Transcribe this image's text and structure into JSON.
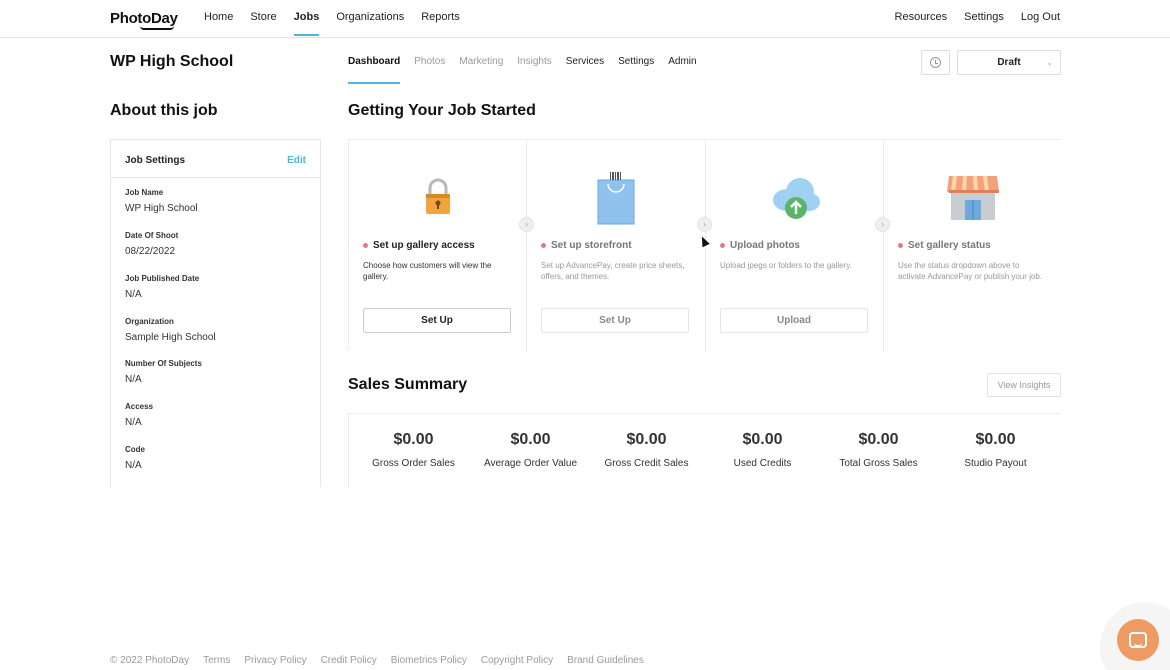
{
  "brand": {
    "logo": "PhotoDay"
  },
  "topnav": {
    "left": [
      {
        "label": "Home",
        "active": false
      },
      {
        "label": "Store",
        "active": false
      },
      {
        "label": "Jobs",
        "active": true
      },
      {
        "label": "Organizations",
        "active": false
      },
      {
        "label": "Reports",
        "active": false
      }
    ],
    "right": [
      {
        "label": "Resources"
      },
      {
        "label": "Settings"
      },
      {
        "label": "Log Out"
      }
    ]
  },
  "job": {
    "title": "WP High School",
    "tabs": [
      {
        "label": "Dashboard",
        "state": "active"
      },
      {
        "label": "Photos",
        "state": "dim"
      },
      {
        "label": "Marketing",
        "state": "dim"
      },
      {
        "label": "Insights",
        "state": "dim"
      },
      {
        "label": "Services",
        "state": "normal"
      },
      {
        "label": "Settings",
        "state": "normal"
      },
      {
        "label": "Admin",
        "state": "normal"
      }
    ],
    "status": "Draft"
  },
  "about": {
    "title": "About this job",
    "card_title": "Job Settings",
    "edit_label": "Edit",
    "fields": [
      {
        "label": "Job Name",
        "value": "WP High School"
      },
      {
        "label": "Date Of Shoot",
        "value": "08/22/2022"
      },
      {
        "label": "Job Published Date",
        "value": "N/A"
      },
      {
        "label": "Organization",
        "value": "Sample High School"
      },
      {
        "label": "Number Of Subjects",
        "value": "N/A"
      },
      {
        "label": "Access",
        "value": "N/A"
      },
      {
        "label": "Code",
        "value": "N/A"
      }
    ]
  },
  "getting_started": {
    "title": "Getting Your Job Started",
    "steps": [
      {
        "title": "Set up gallery access",
        "desc": "Choose how customers will view the gallery.",
        "button": "Set Up",
        "icon": "lock-icon",
        "enabled": true
      },
      {
        "title": "Set up storefront",
        "desc": "Set up AdvancePay, create price sheets, offers, and themes.",
        "button": "Set Up",
        "icon": "shopping-bag-icon",
        "enabled": false
      },
      {
        "title": "Upload photos",
        "desc": "Upload jpegs or folders to the gallery.",
        "button": "Upload",
        "icon": "cloud-upload-icon",
        "enabled": false
      },
      {
        "title": "Set gallery status",
        "desc": "Use the status dropdown above to activate AdvancePay or publish your job.",
        "button": "",
        "icon": "storefront-icon",
        "enabled": false
      }
    ]
  },
  "sales": {
    "title": "Sales Summary",
    "view_insights": "View Insights",
    "metrics": [
      {
        "value": "$0.00",
        "label": "Gross Order Sales"
      },
      {
        "value": "$0.00",
        "label": "Average Order Value"
      },
      {
        "value": "$0.00",
        "label": "Gross Credit Sales"
      },
      {
        "value": "$0.00",
        "label": "Used Credits"
      },
      {
        "value": "$0.00",
        "label": "Total Gross Sales"
      },
      {
        "value": "$0.00",
        "label": "Studio Payout"
      }
    ]
  },
  "footer": {
    "copyright": "© 2022 PhotoDay",
    "links": [
      "Terms",
      "Privacy Policy",
      "Credit Policy",
      "Biometrics Policy",
      "Copyright Policy",
      "Brand Guidelines"
    ]
  },
  "colors": {
    "accent": "#4fb6dc",
    "chat": "#ee9a63",
    "step_dot": "#e07d7d"
  }
}
